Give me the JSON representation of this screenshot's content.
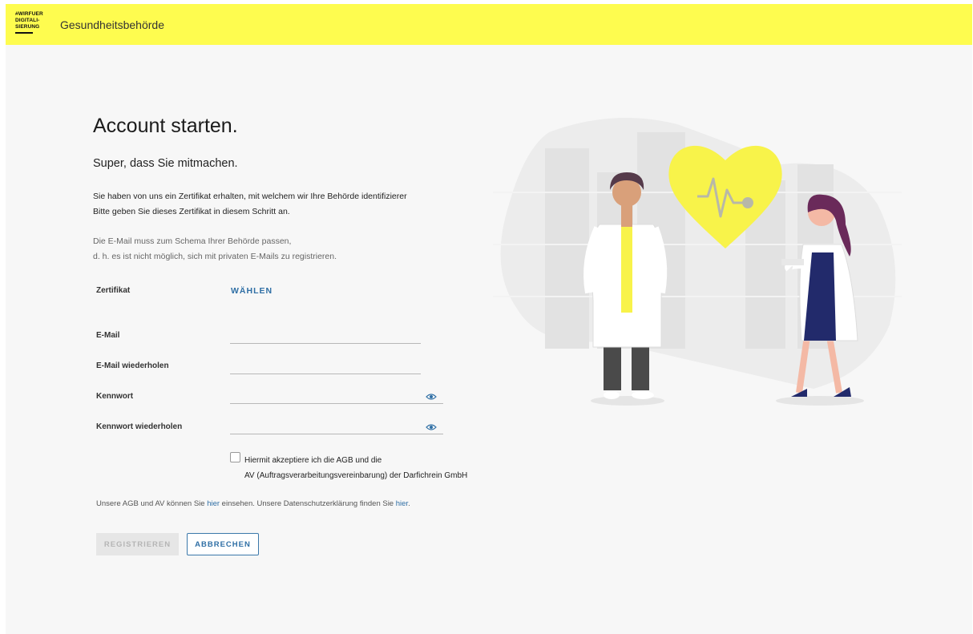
{
  "header": {
    "logo_lines": [
      "#WIRFUER",
      "DIGITALI-",
      "SIERUNG"
    ],
    "brand": "Gesundheitsbehörde"
  },
  "main": {
    "title": "Account starten.",
    "subtitle": "Super, dass Sie mitmachen.",
    "intro_line1": "Sie haben von uns ein Zertifikat erhalten, mit welchem wir Ihre Behörde identifizierer",
    "intro_line2": "Bitte geben Sie dieses Zertifikat in diesem Schritt an.",
    "note_line1": "Die E-Mail muss zum Schema Ihrer Behörde passen,",
    "note_line2": "d. h. es ist nicht möglich, sich mit privaten E-Mails zu registrieren."
  },
  "form": {
    "certificate_label": "Zertifikat",
    "certificate_action": "WÄHLEN",
    "email_label": "E-Mail",
    "email_value": "",
    "email_repeat_label": "E-Mail wiederholen",
    "email_repeat_value": "",
    "password_label": "Kennwort",
    "password_value": "",
    "password_repeat_label": "Kennwort wiederholen",
    "password_repeat_value": "",
    "agb_line1": "Hiermit akzeptiere ich die AGB und die",
    "agb_line2": "AV (Auftragsverarbeitungsvereinbarung) der Darfichrein GmbH",
    "links_prefix": "Unsere AGB und AV können Sie ",
    "link_here_1": "hier",
    "links_middle": " einsehen. Unsere Datenschutzerklärung finden Sie ",
    "link_here_2": "hier",
    "links_suffix": "."
  },
  "buttons": {
    "register": "REGISTRIEREN",
    "cancel": "ABBRECHEN"
  },
  "colors": {
    "header_bg": "#fefc4f",
    "accent": "#2f6fa5",
    "heart": "#f8f34a"
  },
  "icons": [
    "eye-icon",
    "heart-icon",
    "checkbox"
  ]
}
